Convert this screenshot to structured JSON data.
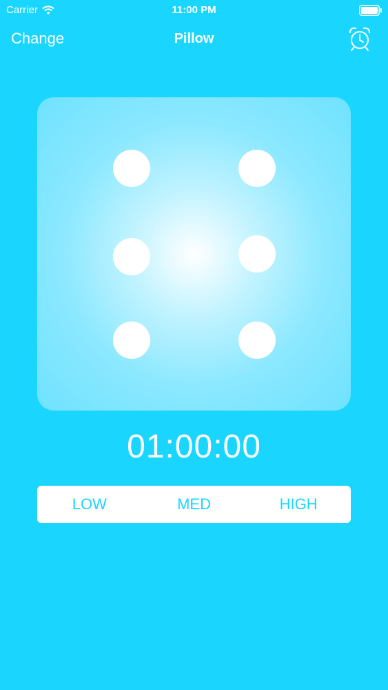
{
  "status_bar": {
    "carrier": "Carrier",
    "time": "11:00 PM"
  },
  "nav": {
    "left_label": "Change",
    "title": "Pillow",
    "right_icon": "alarm-clock-icon"
  },
  "dice": {
    "pips": 6
  },
  "timer": {
    "value": "01:00:00"
  },
  "intensity": {
    "options": [
      "LOW",
      "MED",
      "HIGH"
    ]
  },
  "colors": {
    "background": "#1ad6ff",
    "accent_text": "#1ad6ff",
    "foreground": "#ffffff"
  }
}
